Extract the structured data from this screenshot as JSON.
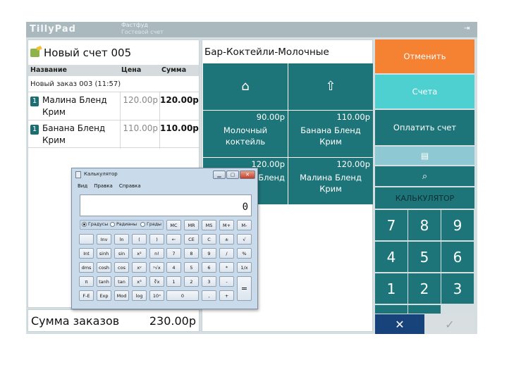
{
  "topbar": {
    "logo": "TillyPad",
    "title": "Фастфуд",
    "subtitle": "Гостевой счет"
  },
  "bill": {
    "title": "Новый счет 005",
    "columns": [
      "Название",
      "Цена",
      "Сумма"
    ],
    "order_header": "Новый заказ 003 (11:57)",
    "items": [
      {
        "qty": "1",
        "name": "Малина Бленд Крим",
        "price": "120.00р",
        "sum": "120.00р"
      },
      {
        "qty": "1",
        "name": "Банана Бленд Крим",
        "price": "110.00р",
        "sum": "110.00р"
      }
    ],
    "total_label": "Сумма заказов",
    "total_value": "230.00р"
  },
  "menu": {
    "category": "Бар-Коктейли-Молочные",
    "nav": [
      {
        "icon": "home-icon",
        "glyph": "⌂"
      },
      {
        "icon": "arrow-up-icon",
        "glyph": "⇧"
      }
    ],
    "tiles": [
      {
        "price": "90.00р",
        "name": "Молочный коктейль"
      },
      {
        "price": "110.00р",
        "name": "Банана Бленд Крим"
      },
      {
        "price": "120.00р",
        "name": "Бленд"
      },
      {
        "price": "120.00р",
        "name": "Малина Бленд Крим"
      }
    ]
  },
  "actions": {
    "cancel": "Отменить",
    "bills": "Счета",
    "pay": "Оплатить счет",
    "calculator": "КАЛЬКУЛЯТОР",
    "keypad": [
      "7",
      "8",
      "9",
      "4",
      "5",
      "6",
      "1",
      "2",
      "3"
    ],
    "colors": {
      "orange": "#f58133",
      "cyan": "#4fd0d0",
      "teal": "#1e7579",
      "light": "#8ec8d2",
      "navy": "#17427a"
    }
  },
  "calculator_window": {
    "title": "Калькулятор",
    "menu": [
      "Вид",
      "Правка",
      "Справка"
    ],
    "display": "0",
    "angle_modes": [
      "Градусы",
      "Радианы",
      "Грады"
    ],
    "memory_keys": [
      "MC",
      "MR",
      "MS",
      "M+",
      "M-"
    ],
    "rows": [
      [
        "",
        "Inv",
        "ln",
        "(",
        ")",
        "←",
        "CE",
        "C",
        "±",
        "√"
      ],
      [
        "Int",
        "sinh",
        "sin",
        "x²",
        "n!",
        "7",
        "8",
        "9",
        "/",
        "%"
      ],
      [
        "dms",
        "cosh",
        "cos",
        "xʸ",
        "ʸ√x",
        "4",
        "5",
        "6",
        "*",
        "1/x"
      ],
      [
        "π",
        "tanh",
        "tan",
        "x³",
        "∛x",
        "1",
        "2",
        "3",
        "-",
        "="
      ],
      [
        "F-E",
        "Exp",
        "Mod",
        "log",
        "10ˣ",
        "0",
        "",
        ",",
        "+",
        ""
      ]
    ]
  }
}
